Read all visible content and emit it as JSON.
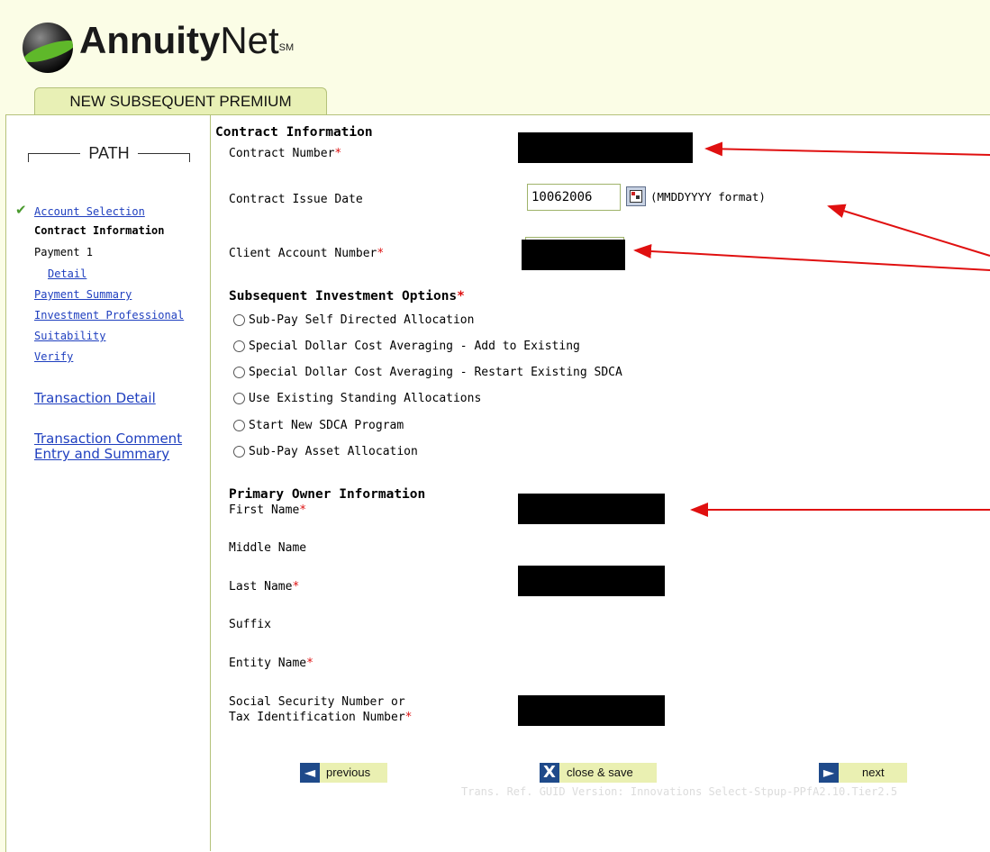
{
  "app": {
    "logo_bold": "Annuity",
    "logo_light": "Net",
    "logo_mark": "SM",
    "tab": "NEW SUBSEQUENT PREMIUM"
  },
  "sidebar": {
    "path_label": "PATH",
    "items": [
      {
        "label": "Account Selection",
        "state": "completed"
      },
      {
        "label": "Contract Information",
        "state": "current"
      },
      {
        "label": "Payment 1",
        "state": "plain"
      },
      {
        "label": "Detail",
        "state": "link"
      },
      {
        "label": "Payment Summary",
        "state": "link"
      },
      {
        "label": "Investment Professional",
        "state": "link"
      },
      {
        "label": "Suitability",
        "state": "link"
      },
      {
        "label": "Verify",
        "state": "link"
      }
    ],
    "transaction_detail": "Transaction Detail",
    "transaction_comment_1": "Transaction Comment",
    "transaction_comment_2": "Entry and Summary"
  },
  "form": {
    "contract_section": "Contract Information",
    "contract_number_label": "Contract Number",
    "contract_issue_date_label": "Contract Issue Date",
    "contract_issue_date_value": "10062006",
    "date_format": "(MMDDYYYY format)",
    "client_account_label": "Client Account Number",
    "options_section": "Subsequent Investment Options",
    "options": [
      "Sub-Pay Self Directed Allocation",
      "Special Dollar Cost Averaging - Add to Existing",
      "Special Dollar Cost Averaging - Restart Existing SDCA",
      "Use Existing Standing Allocations",
      "Start New SDCA Program",
      "Sub-Pay Asset Allocation"
    ],
    "owner_section": "Primary Owner Information",
    "first_name_label": "First Name",
    "middle_name_label": "Middle Name",
    "last_name_label": "Last Name",
    "suffix_label": "Suffix",
    "entity_name_label": "Entity Name",
    "ssn_label_1": "Social Security Number or",
    "ssn_label_2": "Tax Identification Number",
    "required_mark": "*"
  },
  "buttons": {
    "previous": "previous",
    "close_save": "close & save",
    "next": "next"
  },
  "footer": {
    "text": "Trans. Ref. GUID Version: Innovations Select-Stpup-PPfA2.10.Tier2.5"
  },
  "colors": {
    "annotation_arrow": "#e01010",
    "link": "#1f3fbf",
    "accent": "#e8f0b5"
  }
}
